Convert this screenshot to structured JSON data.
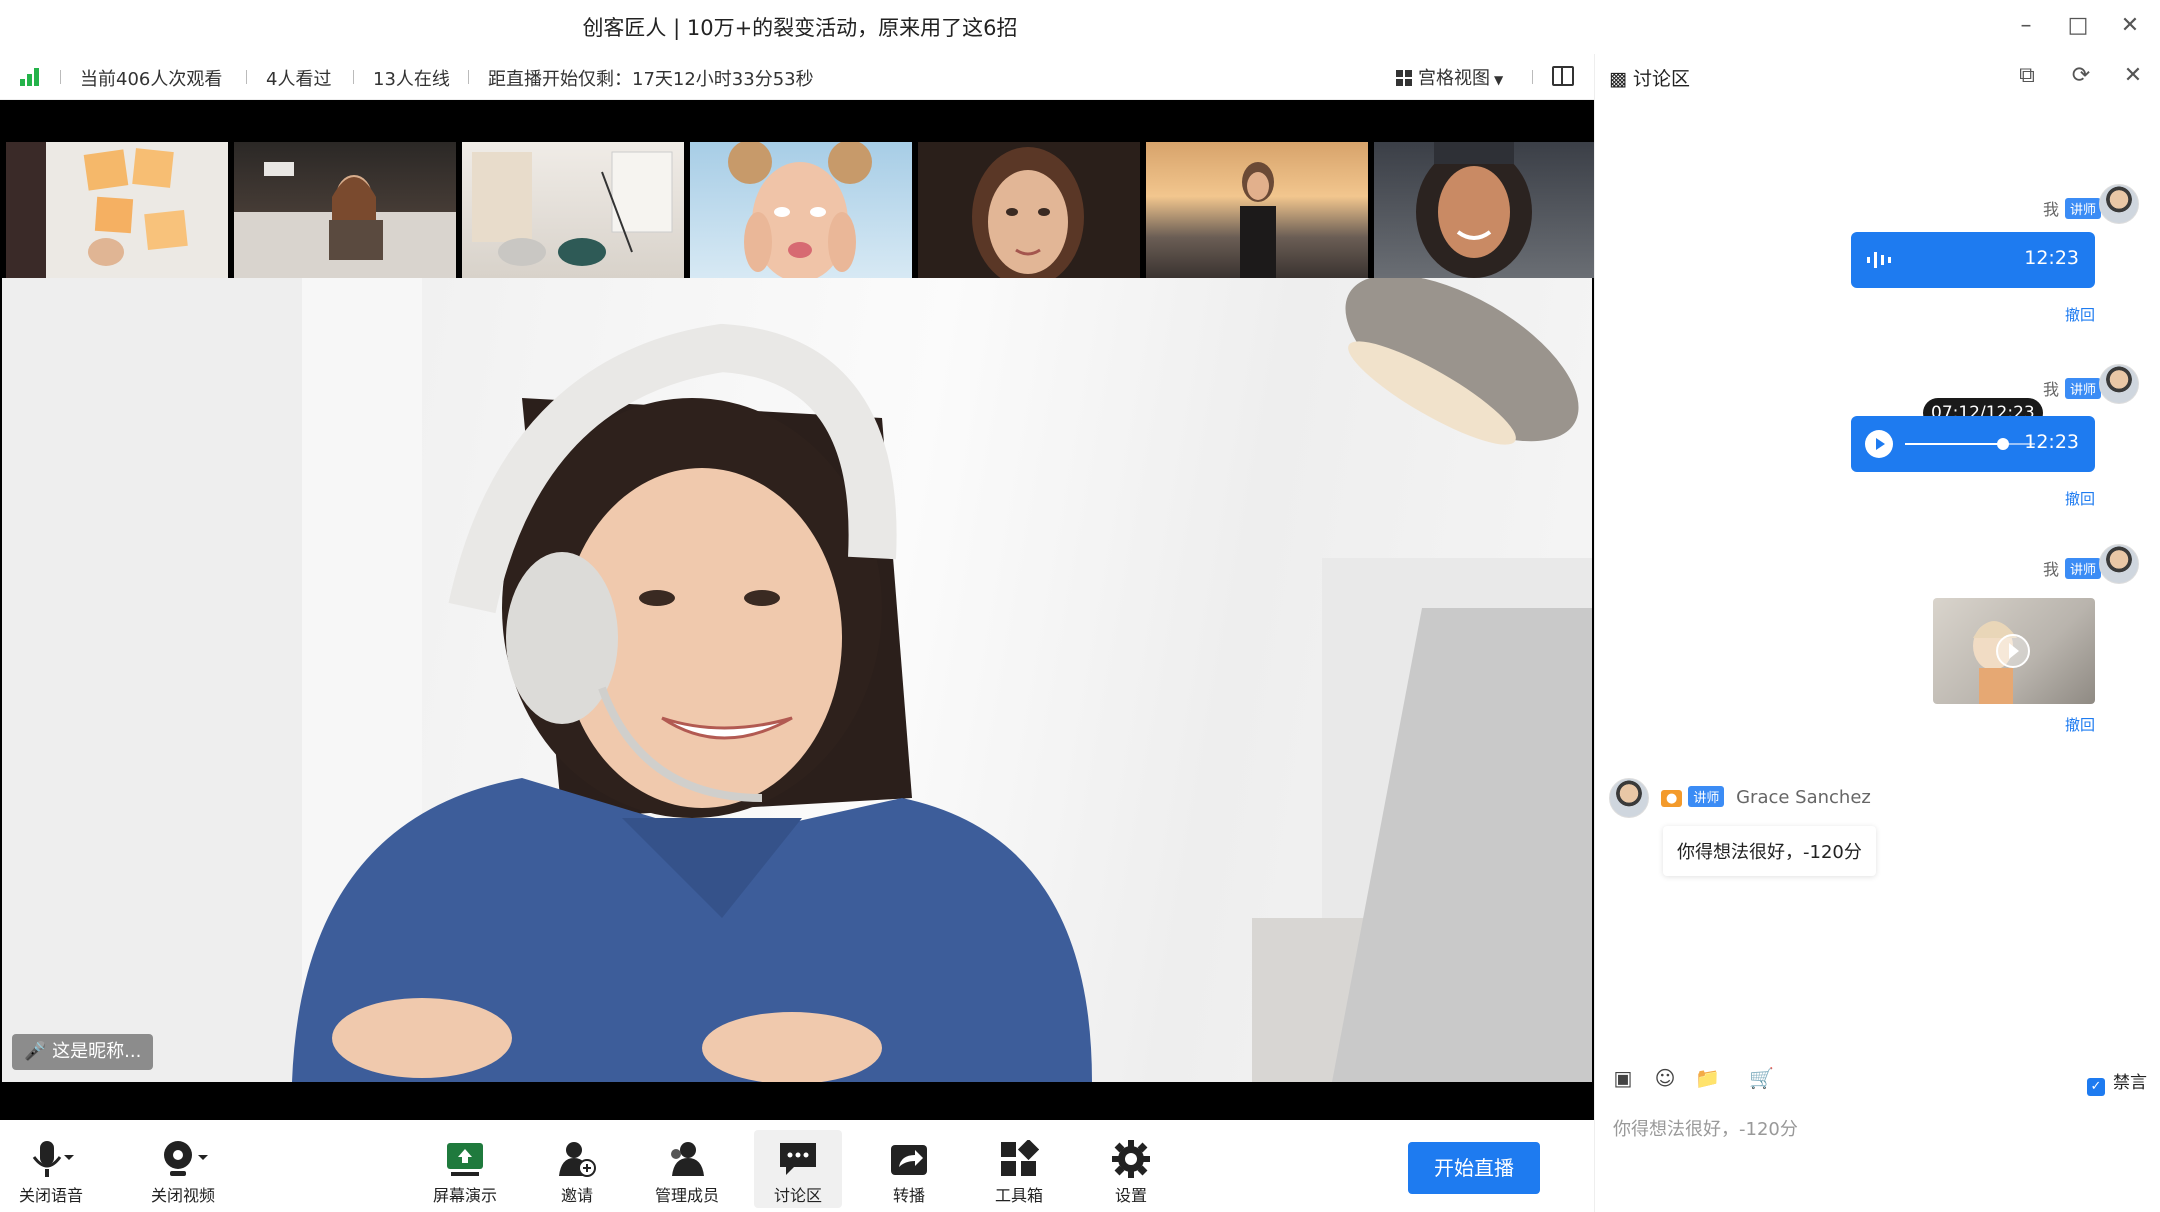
{
  "window": {
    "title": "创客匠人 | 10万+的裂变活动，原来用了这6招",
    "minimize_icon": "minimize-icon",
    "maximize_icon": "maximize-icon",
    "close_icon": "close-icon"
  },
  "infobar": {
    "views": "当前406人次观看",
    "watched": "4人看过",
    "online": "13人在线",
    "countdown": "距直播开始仅剩：17天12小时33分53秒",
    "view_mode": "宫格视图",
    "signal_color": "#24b34a"
  },
  "stage": {
    "nameplate": "这是昵称..."
  },
  "toolbar": {
    "mute_audio": "关闭语音",
    "mute_video": "关闭视频",
    "screen_share": "屏幕演示",
    "invite": "邀请",
    "manage_members": "管理成员",
    "discussion": "讨论区",
    "forward": "转播",
    "toolbox": "工具箱",
    "settings": "设置",
    "start_live": "开始直播",
    "accent": "#1e7bf0"
  },
  "panel": {
    "title": "讨论区",
    "messages": [
      {
        "sender": "我",
        "role": "讲师",
        "type": "voice",
        "duration": "12:23",
        "withdraw": "撤回"
      },
      {
        "sender": "我",
        "role": "讲师",
        "type": "voice-playing",
        "duration": "12:23",
        "progress_tooltip": "07:12/12:23",
        "progress": 0.75,
        "withdraw": "撤回"
      },
      {
        "sender": "我",
        "role": "讲师",
        "type": "video",
        "withdraw": "撤回"
      },
      {
        "sender": "Grace Sanchez",
        "role": "讲师",
        "badge": "group-badge-icon",
        "type": "text",
        "text": "你得想法很好，-120分"
      }
    ],
    "composer": {
      "mute_label": "禁言",
      "mute_checked": true,
      "input_value": "你得想法很好，-120分"
    }
  }
}
